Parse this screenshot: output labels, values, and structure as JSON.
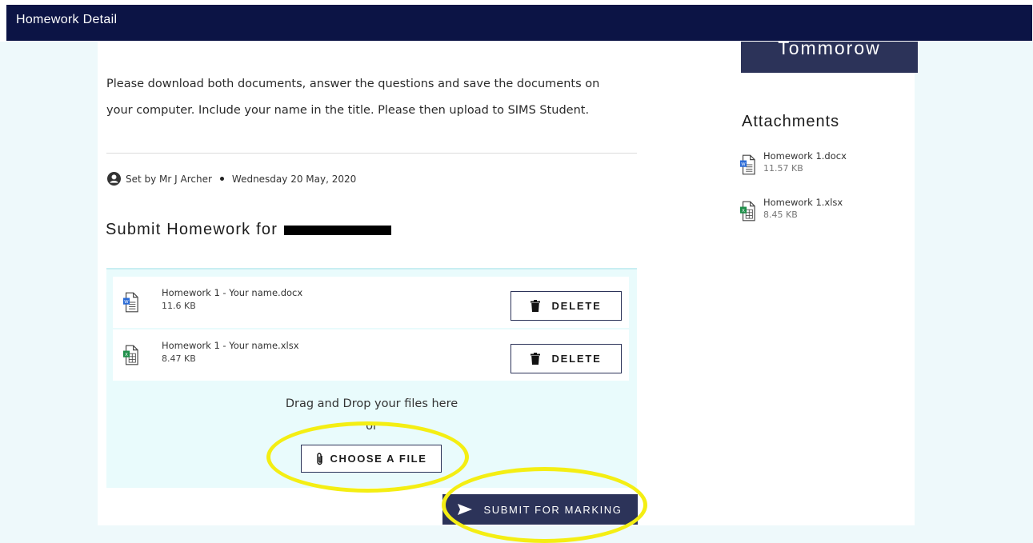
{
  "window": {
    "title": "Homework Detail"
  },
  "due": {
    "label": "Tommorow"
  },
  "homework": {
    "description": "Please download both documents, answer the questions and save the documents on your computer. Include your name in the title. Please then upload to SIMS Student.",
    "set_by": "Set by Mr J Archer",
    "date": "Wednesday 20 May, 2020"
  },
  "submit": {
    "heading": "Submit Homework for",
    "files": [
      {
        "name": "Homework 1 - Your name.docx",
        "size": "11.6 KB",
        "icon": "word-document-icon"
      },
      {
        "name": "Homework 1 - Your name.xlsx",
        "size": "8.47 KB",
        "icon": "excel-document-icon"
      }
    ],
    "delete_label": "DELETE",
    "drag_text": "Drag and Drop your files here",
    "or_text": "or",
    "choose_label": "CHOOSE A FILE",
    "submit_label": "SUBMIT FOR MARKING"
  },
  "attachments": {
    "title": "Attachments",
    "items": [
      {
        "name": "Homework 1.docx",
        "size": "11.57 KB",
        "icon": "word-document-icon"
      },
      {
        "name": "Homework 1.xlsx",
        "size": "8.45 KB",
        "icon": "excel-document-icon"
      }
    ]
  },
  "colors": {
    "header": "#0c1445",
    "button": "#2c3359",
    "highlight": "#f4ee13",
    "dropzone": "#e9fbfc"
  }
}
